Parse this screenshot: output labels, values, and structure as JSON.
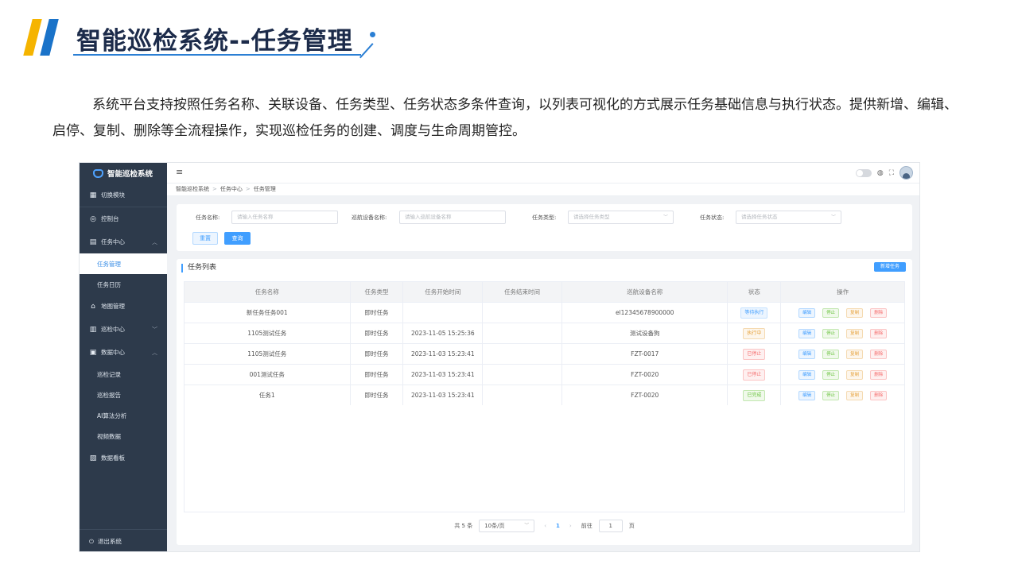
{
  "slide": {
    "title": "智能巡检系统--任务管理",
    "description": "系统平台支持按照任务名称、关联设备、任务类型、任务状态多条件查询，以列表可视化的方式展示任务基础信息与执行状态。提供新增、编辑、启停、复制、删除等全流程操作，实现巡检任务的创建、调度与生命周期管控。"
  },
  "app": {
    "brand": "智能巡检系统",
    "sidebar": {
      "switch_module": "切换模块",
      "console": "控制台",
      "task_center": "任务中心",
      "task_manage": "任务管理",
      "task_calendar": "任务日历",
      "map_manage": "地图管理",
      "patrol_center": "巡检中心",
      "data_center": "数据中心",
      "patrol_record": "巡检记录",
      "patrol_report": "巡检报告",
      "ai_analysis": "AI算法分析",
      "video_data": "视频数据",
      "data_board": "数据看板",
      "logout": "退出系统"
    },
    "breadcrumb": [
      "智能巡检系统",
      "任务中心",
      "任务管理"
    ],
    "search": {
      "name_label": "任务名称:",
      "name_placeholder": "请输入任务名称",
      "device_label": "巡航设备名称:",
      "device_placeholder": "请输入巡航设备名称",
      "type_label": "任务类型:",
      "type_placeholder": "请选择任务类型",
      "status_label": "任务状态:",
      "status_placeholder": "请选择任务状态",
      "reset": "重置",
      "query": "查询"
    },
    "list": {
      "title": "任务列表",
      "add_button": "新增任务",
      "columns": [
        "任务名称",
        "任务类型",
        "任务开始时间",
        "任务结束时间",
        "巡航设备名称",
        "状态",
        "操作"
      ],
      "rows": [
        {
          "name": "新任务任务001",
          "type": "即时任务",
          "start": "",
          "end": "",
          "device": "el12345678900000",
          "status": "等待执行",
          "status_color": "blue"
        },
        {
          "name": "1105测试任务",
          "type": "即时任务",
          "start": "2023-11-05 15:25:36",
          "end": "",
          "device": "测试设备狗",
          "status": "执行中",
          "status_color": "orange"
        },
        {
          "name": "1105测试任务",
          "type": "即时任务",
          "start": "2023-11-03 15:23:41",
          "end": "",
          "device": "FZT-0017",
          "status": "已停止",
          "status_color": "red"
        },
        {
          "name": "001测试任务",
          "type": "即时任务",
          "start": "2023-11-03 15:23:41",
          "end": "",
          "device": "FZT-0020",
          "status": "已停止",
          "status_color": "red"
        },
        {
          "name": "任务1",
          "type": "即时任务",
          "start": "2023-11-03 15:23:41",
          "end": "",
          "device": "FZT-0020",
          "status": "已完成",
          "status_color": "green"
        }
      ],
      "ops": {
        "edit": "编辑",
        "stop": "停止",
        "copy": "复制",
        "delete": "删除"
      }
    },
    "pager": {
      "total": "共 5 条",
      "page_size": "10条/页",
      "prev": "‹",
      "current": "1",
      "next": "›",
      "goto_label": "前往",
      "goto_value": "1",
      "page_unit": "页"
    },
    "colors": {
      "sidebar_bg": "#2d3a4b",
      "accent": "#409eff",
      "title_bar_yellow": "#f5b400",
      "title_bar_blue": "#1a73c9"
    }
  }
}
